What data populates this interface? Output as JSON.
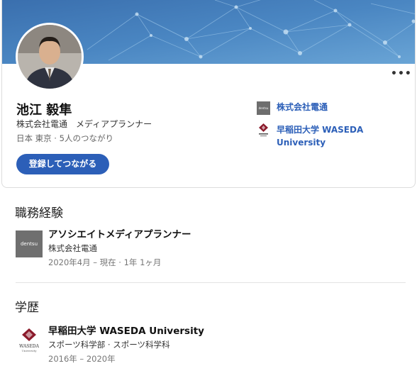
{
  "profile": {
    "name": "池江 毅隼",
    "headline": "株式会社電通　メディアプランナー",
    "location": "日本 東京 · 5人のつながり",
    "connect_label": "登録してつながる",
    "more_label": "•••",
    "sidebar": [
      {
        "label": "株式会社電通",
        "logo": "dentsu-logo",
        "logo_text": "dentsu"
      },
      {
        "label": "早稲田大学 WASEDA University",
        "logo": "waseda-logo"
      }
    ]
  },
  "experience": {
    "title": "職務経験",
    "items": [
      {
        "logo": "dentsu-logo",
        "logo_text": "dentsu",
        "role": "アソシエイトメディアプランナー",
        "company": "株式会社電通",
        "period": "2020年4月 – 現在 · 1年 1ヶ月"
      }
    ]
  },
  "education": {
    "title": "学歴",
    "items": [
      {
        "logo": "waseda-logo",
        "logo_text_1": "WASEDA",
        "logo_text_2": "University",
        "school": "早稲田大学 WASEDA University",
        "program": "スポーツ科学部 · スポーツ科学科",
        "period": "2016年 – 2020年"
      }
    ]
  },
  "colors": {
    "accent": "#2c5fb8",
    "banner_dark": "#3f78b8",
    "banner_light": "#7fb2dd",
    "waseda_red": "#8b1a2b"
  }
}
